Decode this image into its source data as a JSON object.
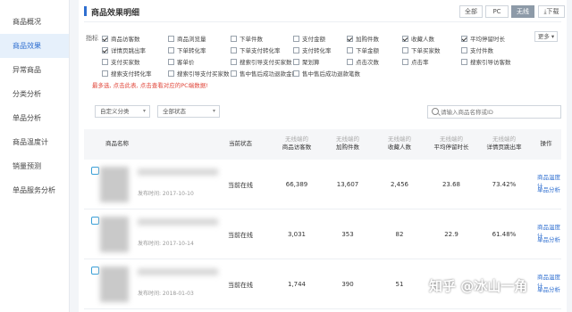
{
  "sidebar": {
    "items": [
      {
        "label": "商品概况"
      },
      {
        "label": "商品效果",
        "active": true
      },
      {
        "label": "异常商品"
      },
      {
        "label": "分类分析"
      },
      {
        "label": "单品分析"
      },
      {
        "label": "商品温度计"
      },
      {
        "label": "销量预测"
      },
      {
        "label": "单品服务分析"
      }
    ]
  },
  "header": {
    "title": "商品效果明细",
    "segments": [
      "全部",
      "PC",
      "无线"
    ],
    "active_segment": "无线",
    "download_label": "下载"
  },
  "filters": {
    "label": "指标",
    "more_label": "更多",
    "options": [
      {
        "label": "商品访客数",
        "checked": true
      },
      {
        "label": "商品浏览量",
        "checked": false
      },
      {
        "label": "下单件数",
        "checked": false
      },
      {
        "label": "支付金额",
        "checked": false
      },
      {
        "label": "加购件数",
        "checked": true
      },
      {
        "label": "收藏人数",
        "checked": true
      },
      {
        "label": "平均停留时长",
        "checked": true
      },
      {
        "label": "详情页跳出率",
        "checked": true
      },
      {
        "label": "下单转化率",
        "checked": false
      },
      {
        "label": "下单支付转化率",
        "checked": false
      },
      {
        "label": "支付转化率",
        "checked": false
      },
      {
        "label": "下单金额",
        "checked": false
      },
      {
        "label": "下单买家数",
        "checked": false
      },
      {
        "label": "支付件数",
        "checked": false
      },
      {
        "label": "支付买家数",
        "checked": false
      },
      {
        "label": "客单价",
        "checked": false
      },
      {
        "label": "搜索引导支付买家数",
        "checked": false
      },
      {
        "label": "聚划算",
        "checked": false
      },
      {
        "label": "点击次数",
        "checked": false
      },
      {
        "label": "点击率",
        "checked": false
      },
      {
        "label": "搜索引导访客数",
        "checked": false
      },
      {
        "label": "搜索支付转化率",
        "checked": false
      },
      {
        "label": "搜索引导支付买家数",
        "checked": false
      },
      {
        "label": "售中售后成功退款金额",
        "checked": false
      },
      {
        "label": "售中售后成功退款笔数",
        "checked": false
      }
    ],
    "note": "最多选, 点击此表, 点击查看对应的PC端数据!"
  },
  "controls": {
    "category_select": "自定义分类",
    "status_select": "全部状态",
    "search_placeholder": "请输入商品名称或ID"
  },
  "table": {
    "columns": [
      {
        "sub": "",
        "label": "商品名称"
      },
      {
        "sub": "",
        "label": "当前状态"
      },
      {
        "sub": "无线端的",
        "label": "商品访客数"
      },
      {
        "sub": "无线端的",
        "label": "加购件数"
      },
      {
        "sub": "无线端的",
        "label": "收藏人数"
      },
      {
        "sub": "无线端的",
        "label": "平均停留时长"
      },
      {
        "sub": "无线端的",
        "label": "详情页跳出率"
      },
      {
        "sub": "",
        "label": "操作"
      }
    ],
    "rows": [
      {
        "date": "发布时间: 2017-10-10",
        "status": "当前在线",
        "visitors": "66,389",
        "cart": "13,607",
        "fav": "2,456",
        "stay": "23.68",
        "bounce": "73.42%",
        "op1": "商品温度计",
        "op2": "单品分析"
      },
      {
        "date": "发布时间: 2017-10-14",
        "status": "当前在线",
        "visitors": "3,031",
        "cart": "353",
        "fav": "82",
        "stay": "22.9",
        "bounce": "61.48%",
        "op1": "商品温度计",
        "op2": "单品分析"
      },
      {
        "date": "发布时间: 2018-01-03",
        "status": "当前在线",
        "visitors": "1,744",
        "cart": "390",
        "fav": "51",
        "stay": "",
        "bounce": "",
        "op1": "商品温度计",
        "op2": "单品分析"
      }
    ]
  },
  "watermark": "知乎 @冰山一角"
}
